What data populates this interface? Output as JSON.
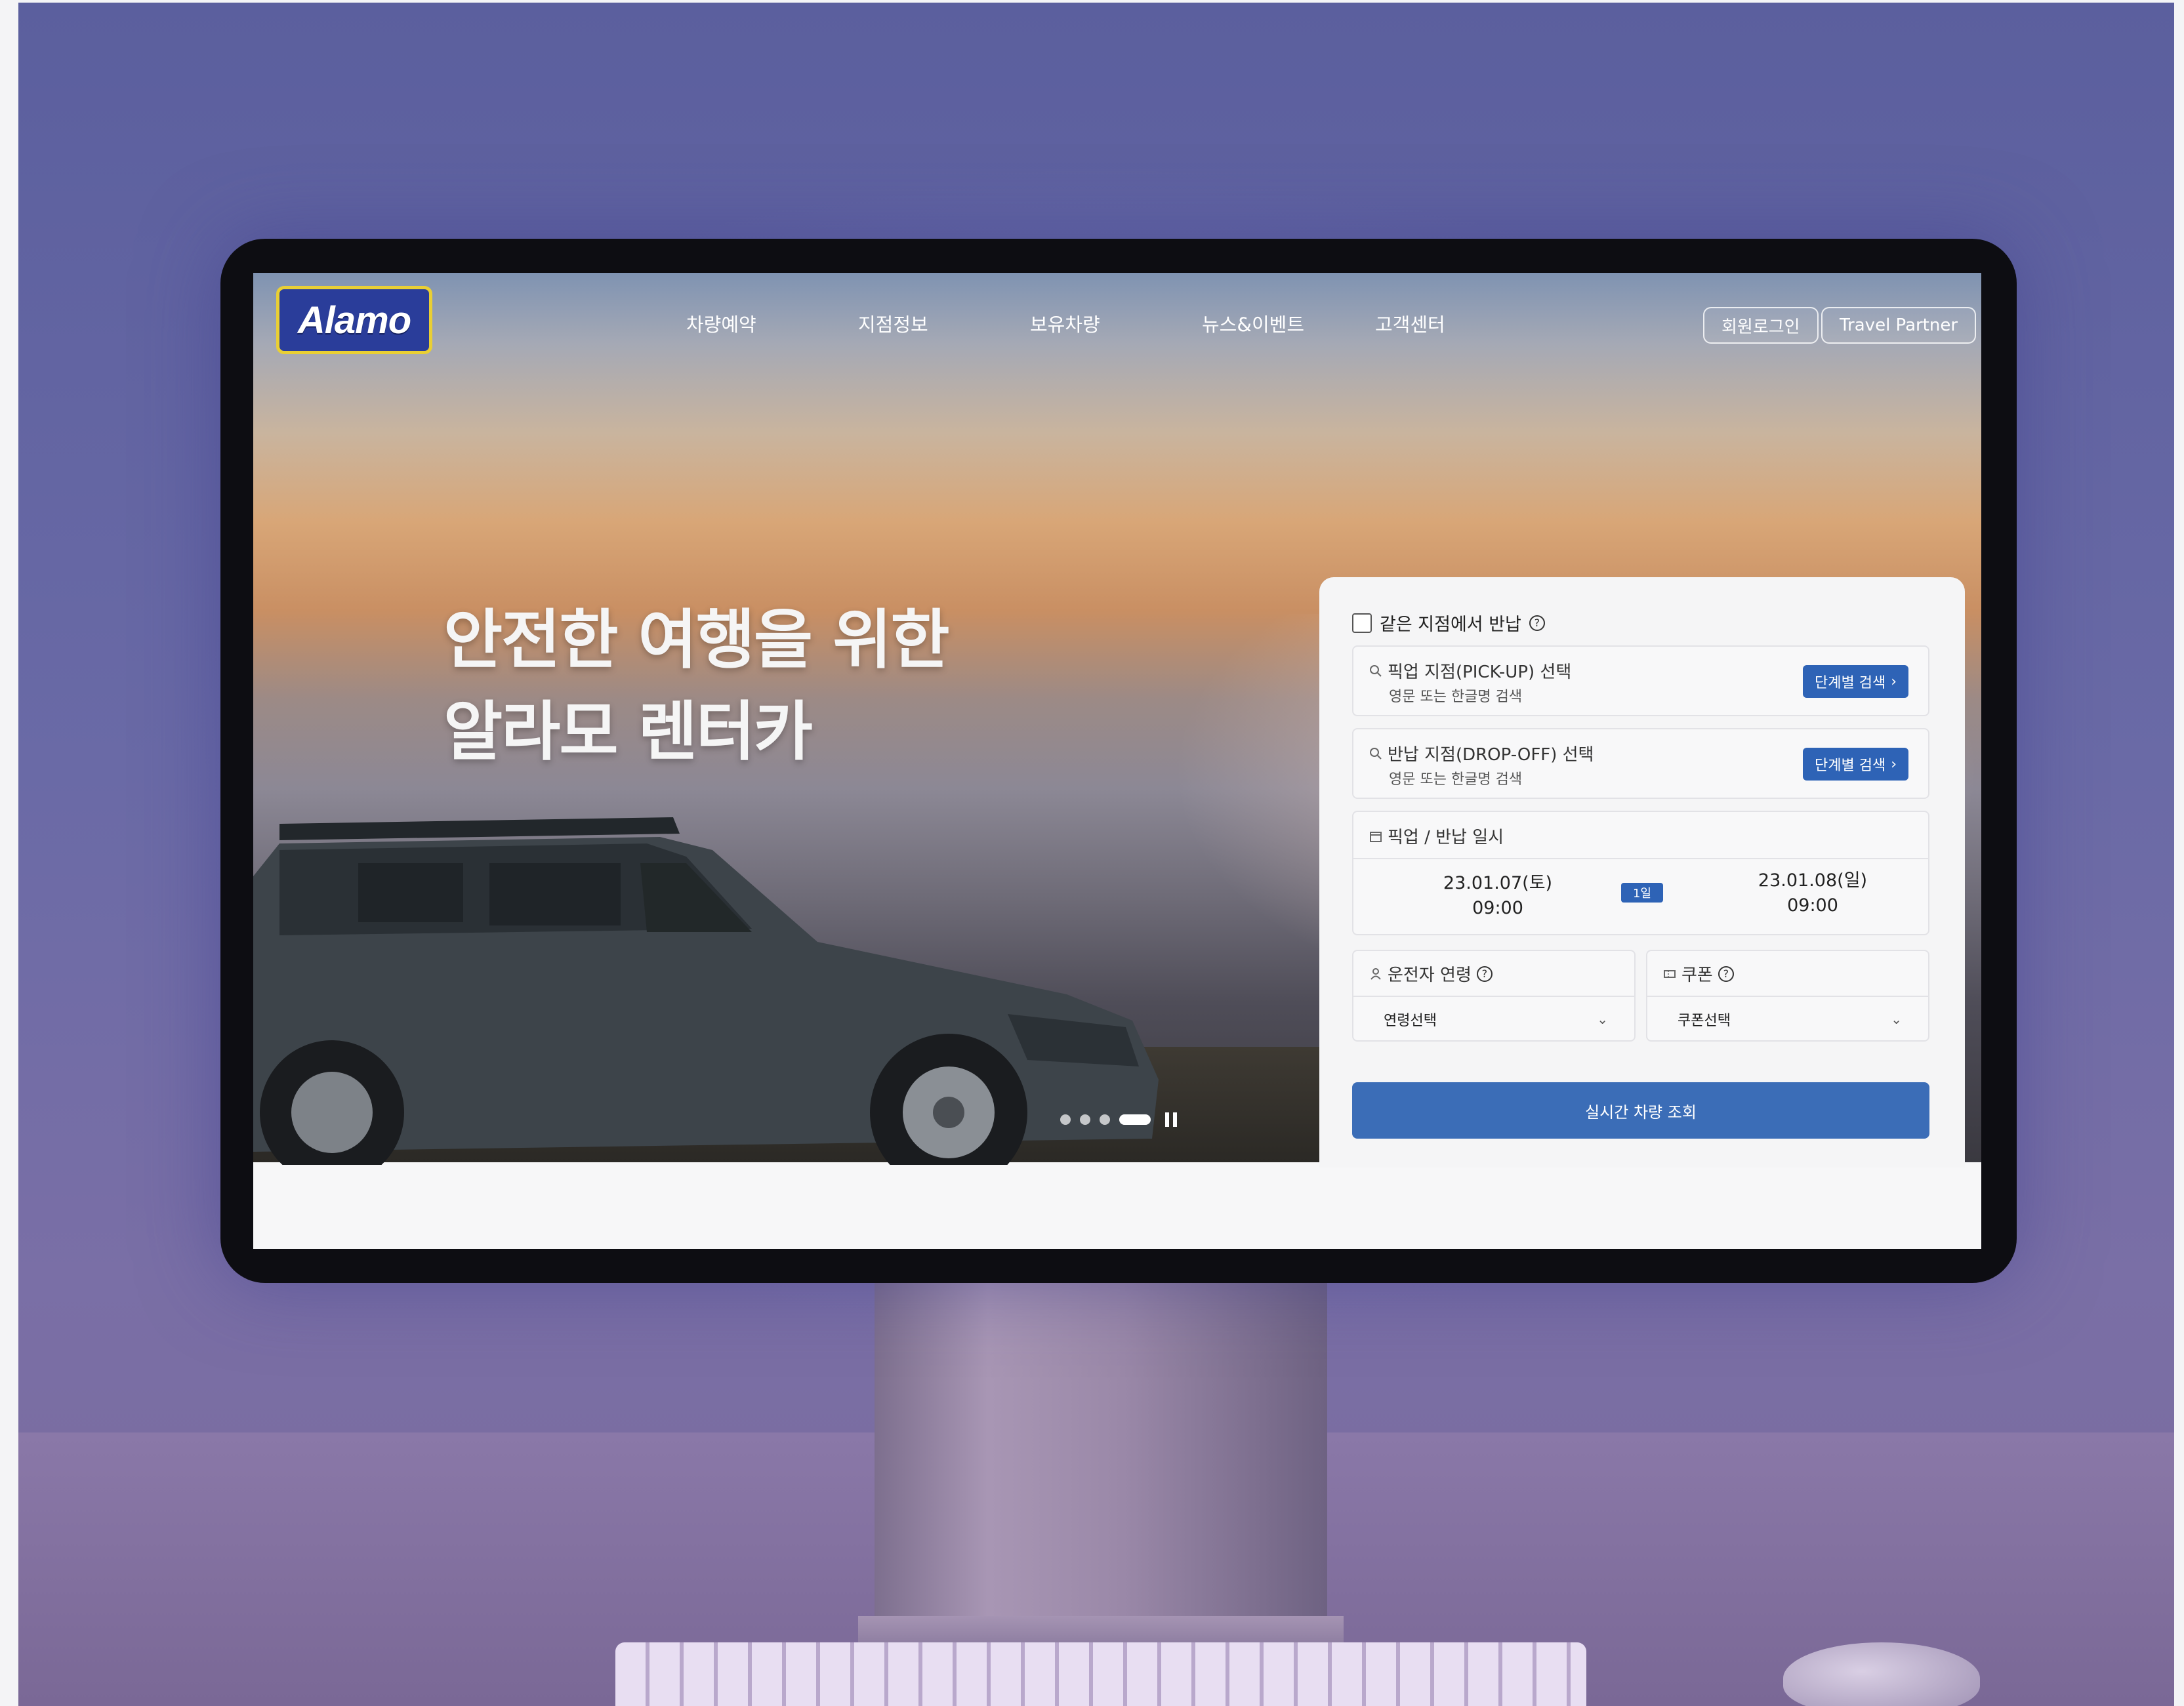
{
  "header": {
    "logo_text": "Alamo",
    "nav": [
      "차량예약",
      "지점정보",
      "보유차량",
      "뉴스&이벤트",
      "고객센터"
    ],
    "login_label": "회원로그인",
    "partner_label": "Travel Partner"
  },
  "hero": {
    "headline_line1": "안전한 여행을 위한",
    "headline_line2": "알라모 렌터카",
    "slide_count": 4,
    "active_slide": 4
  },
  "booking": {
    "same_location_label": "같은 지점에서 반납",
    "pickup_title": "픽업 지점(PICK-UP) 선택",
    "pickup_sub": "영문 또는 한글명 검색",
    "dropoff_title": "반납 지점(DROP-OFF) 선택",
    "dropoff_sub": "영문 또는 한글명 검색",
    "step_search_label": "단계별 검색",
    "datetime_title": "픽업 / 반납 일시",
    "pickup_date": "23.01.07(토)",
    "pickup_time": "09:00",
    "return_date": "23.01.08(일)",
    "return_time": "09:00",
    "duration_badge": "1일",
    "driver_age_title": "운전자 연령",
    "driver_age_value": "연령선택",
    "coupon_title": "쿠폰",
    "coupon_value": "쿠폰선택",
    "search_button": "실시간 차량 조회"
  },
  "icons": {
    "search": "search-icon",
    "calendar": "calendar-icon",
    "person": "person-icon",
    "coupon": "coupon-icon",
    "help": "help-icon",
    "chevron": "chevron-down-icon"
  },
  "colors": {
    "accent": "#2e63b6",
    "logo_bg": "#2a3d9a",
    "logo_border": "#e9cf34"
  }
}
